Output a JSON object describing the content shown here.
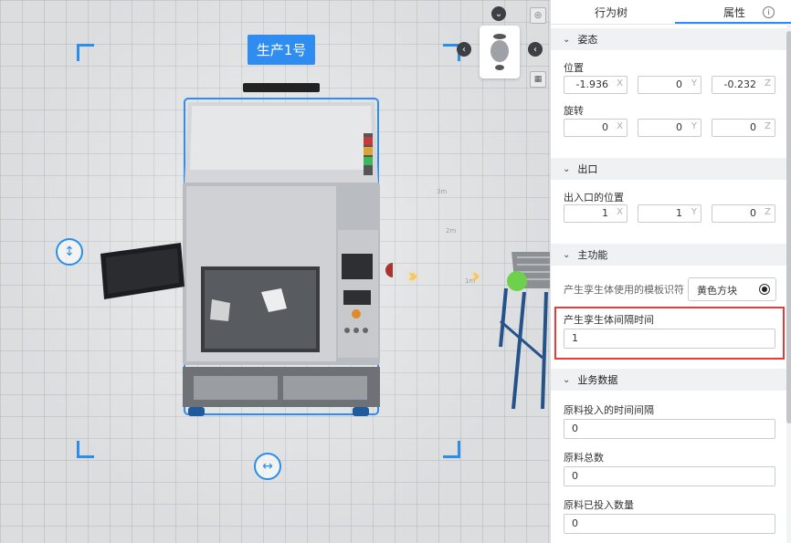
{
  "viewport": {
    "object_label": "生产1号",
    "ground_marks": [
      "3m",
      "2m",
      "1m"
    ]
  },
  "panel": {
    "tabs": [
      {
        "label": "行为树",
        "active": false
      },
      {
        "label": "属性",
        "active": true
      }
    ],
    "sections": {
      "pose": {
        "title": "姿态",
        "position_label": "位置",
        "position": {
          "x": "-1.936",
          "y": "0",
          "z": "-0.232"
        },
        "rotation_label": "旋转",
        "rotation": {
          "x": "0",
          "y": "0",
          "z": "0"
        }
      },
      "exit": {
        "title": "出口",
        "port_label": "出入口的位置",
        "port": {
          "x": "1",
          "y": "1",
          "z": "0"
        }
      },
      "main": {
        "title": "主功能",
        "template_label": "产生孪生体使用的模板识符",
        "template_value": "黄色方块",
        "interval_label": "产生孪生体间隔时间",
        "interval_value": "1"
      },
      "business": {
        "title": "业务数据",
        "fields": [
          {
            "label": "原料投入的时间间隔",
            "value": "0"
          },
          {
            "label": "原料总数",
            "value": "0"
          },
          {
            "label": "原料已投入数量",
            "value": "0"
          }
        ]
      }
    },
    "axis_labels": {
      "x": "X",
      "y": "Y",
      "z": "Z"
    }
  },
  "colors": {
    "accent": "#2f8cf0",
    "highlight": "#e53b3b"
  }
}
